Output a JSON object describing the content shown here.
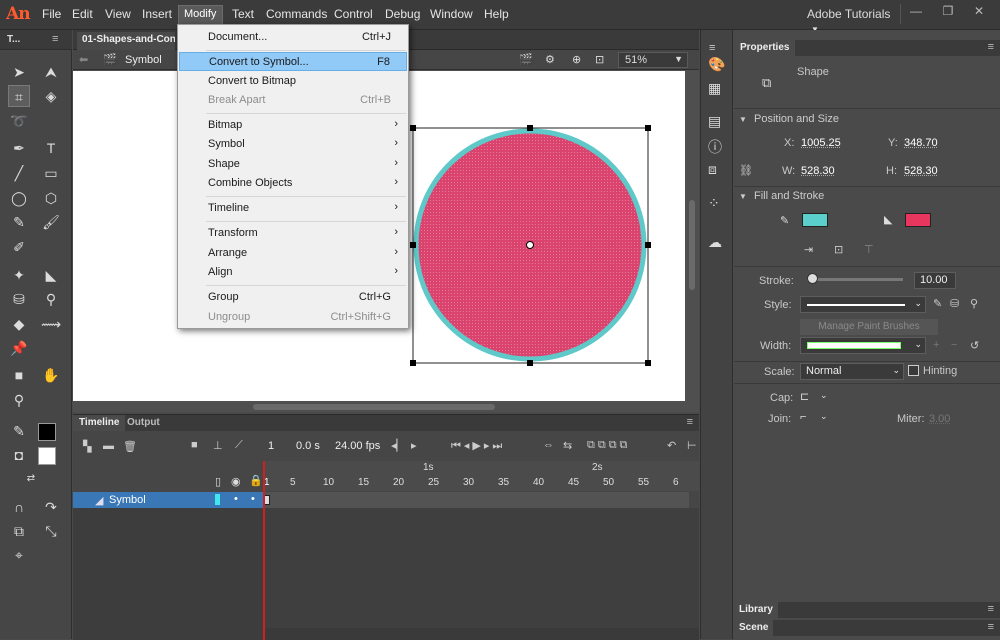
{
  "app": {
    "logo": "An"
  },
  "menubar": {
    "items": [
      "File",
      "Edit",
      "View",
      "Insert",
      "Modify",
      "Text",
      "Commands",
      "Control",
      "Debug",
      "Window",
      "Help"
    ],
    "workspace": "Adobe Tutorials"
  },
  "tools": {
    "header": "T..."
  },
  "document": {
    "tab": "01-Shapes-and-Conta",
    "scene_label": "Symbol",
    "zoom": "51%"
  },
  "modify_menu": {
    "items": [
      {
        "label": "Document...",
        "shortcut": "Ctrl+J"
      },
      {
        "label": "Convert to Symbol...",
        "shortcut": "F8"
      },
      {
        "label": "Convert to Bitmap",
        "shortcut": ""
      },
      {
        "label": "Break Apart",
        "shortcut": "Ctrl+B"
      },
      {
        "label": "Bitmap",
        "shortcut": ""
      },
      {
        "label": "Symbol",
        "shortcut": ""
      },
      {
        "label": "Shape",
        "shortcut": ""
      },
      {
        "label": "Combine Objects",
        "shortcut": ""
      },
      {
        "label": "Timeline",
        "shortcut": ""
      },
      {
        "label": "Transform",
        "shortcut": ""
      },
      {
        "label": "Arrange",
        "shortcut": ""
      },
      {
        "label": "Align",
        "shortcut": ""
      },
      {
        "label": "Group",
        "shortcut": "Ctrl+G"
      },
      {
        "label": "Ungroup",
        "shortcut": "Ctrl+Shift+G"
      }
    ]
  },
  "stage": {
    "circle_fill": "#d9436e",
    "circle_stroke": "#5fc8c8"
  },
  "timeline": {
    "tab_timeline": "Timeline",
    "tab_output": "Output",
    "current_frame": "1",
    "time": "0.0 s",
    "fps": "24.00 fps",
    "ruler_sec": [
      "1s",
      "2s"
    ],
    "ruler_frames": [
      "1",
      "5",
      "10",
      "15",
      "20",
      "25",
      "30",
      "35",
      "40",
      "45",
      "50",
      "55",
      "6"
    ],
    "layer_name": "Symbol"
  },
  "properties": {
    "tab": "Properties",
    "type": "Shape",
    "position_section": "Position and Size",
    "x_label": "X:",
    "x": "1005.25",
    "y_label": "Y:",
    "y": "348.70",
    "w_label": "W:",
    "w": "528.30",
    "h_label": "H:",
    "h": "528.30",
    "fill_section": "Fill and Stroke",
    "stroke_color": "#5bcfcb",
    "fill_color": "#e8365f",
    "stroke_label": "Stroke:",
    "stroke_value": "10.00",
    "style_label": "Style:",
    "manage_brushes": "Manage Paint Brushes",
    "width_label": "Width:",
    "scale_label": "Scale:",
    "scale_value": "Normal",
    "hinting": "Hinting",
    "cap_label": "Cap:",
    "join_label": "Join:",
    "miter_label": "Miter:",
    "miter_value": "3.00",
    "library_tab": "Library",
    "scene_tab": "Scene"
  }
}
